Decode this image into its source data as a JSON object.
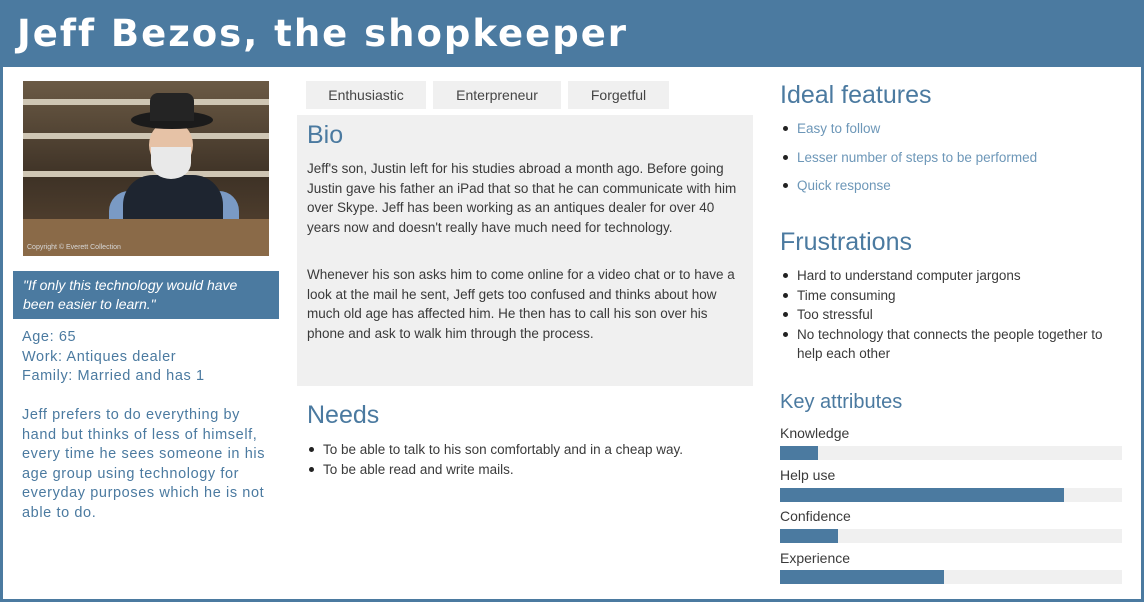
{
  "title": "Jeff Bezos, the shopkeeper",
  "photo": {
    "credit": "Copyright © Everett Collection",
    "alt": "shopkeeper-photo"
  },
  "quote": "\"If only this technology would have been easier to learn.\"",
  "demographics": {
    "age": "Age: 65",
    "work": "Work: Antiques dealer",
    "family": "Family: Married and has 1"
  },
  "description": "Jeff prefers to do everything by hand but thinks of less of himself, every time he sees someone in his age group using technology for everyday purposes which he is not able to do.",
  "tags": [
    "Enthusiastic",
    "Enterpreneur",
    "Forgetful"
  ],
  "bio": {
    "title": "Bio",
    "paragraphs": [
      "Jeff's son, Justin left for his studies abroad a month ago. Before going Justin gave his father an iPad that so that he can communicate with him over Skype. Jeff has been working as an antiques dealer for over 40 years now and doesn't really have much need for technology.",
      "Whenever his son asks him to come online for a video chat or to have a look at the mail he sent, Jeff gets too confused and thinks about how much old age has affected him. He then has to call his son over his phone and ask to walk him through the process."
    ]
  },
  "needs": {
    "title": "Needs",
    "items": [
      "To be able to talk to his son comfortably and in a cheap way.",
      "To be able read and write mails."
    ]
  },
  "ideal_features": {
    "title": "Ideal features",
    "items": [
      "Easy to follow",
      "Lesser number of steps to be performed",
      "Quick response"
    ]
  },
  "frustrations": {
    "title": "Frustrations",
    "items": [
      "Hard to understand computer jargons",
      "Time consuming",
      "Too stressful",
      "No technology that connects the people together to help each other"
    ]
  },
  "key_attributes": {
    "title": "Key attributes",
    "items": [
      {
        "label": "Knowledge",
        "value": 0.11
      },
      {
        "label": "Help use",
        "value": 0.83
      },
      {
        "label": "Confidence",
        "value": 0.17
      },
      {
        "label": "Experience",
        "value": 0.48
      }
    ]
  },
  "colors": {
    "accent": "#4b7aa0",
    "panel": "#f0f0f0",
    "light_text": "#6d97b8"
  }
}
